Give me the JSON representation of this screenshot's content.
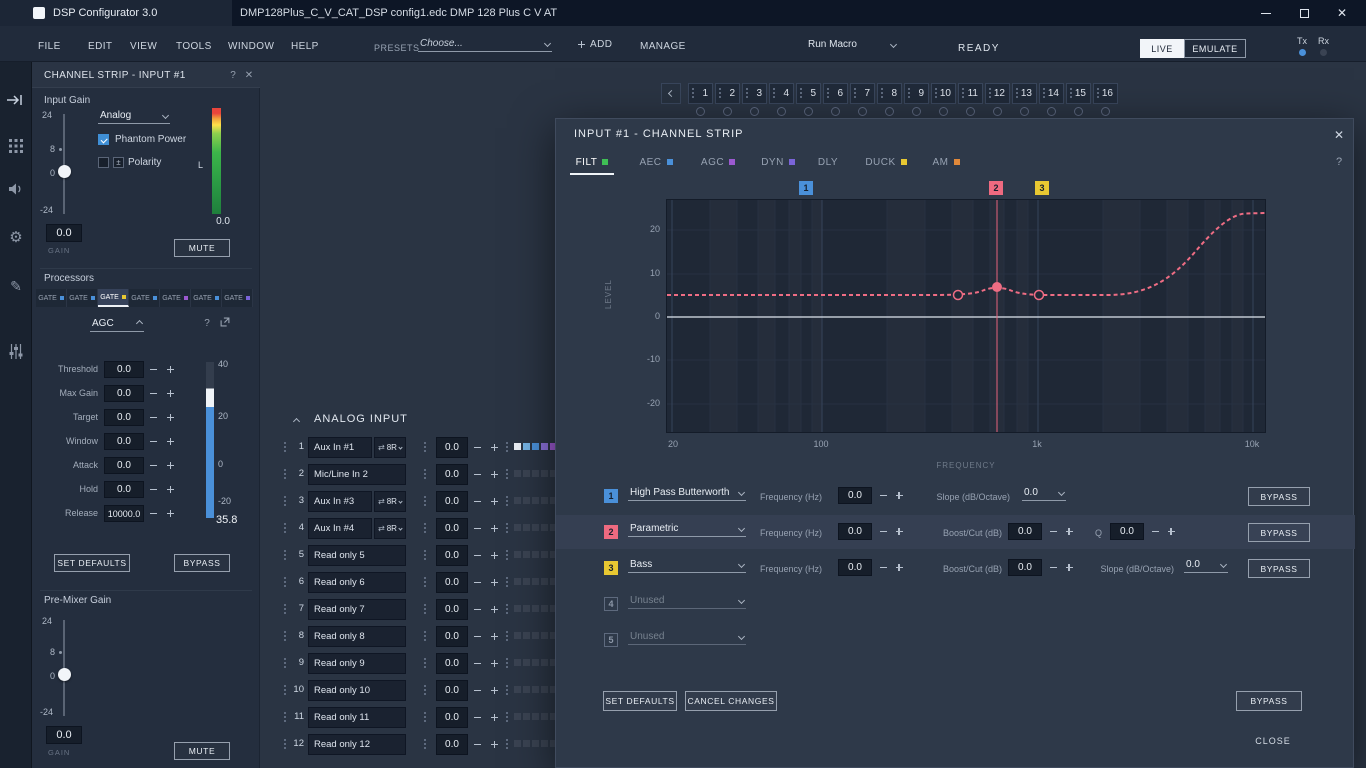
{
  "glyphs": {
    "close": "✕",
    "help": "?",
    "gear": "⚙",
    "pencil": "✎",
    "swap": "⇄",
    "polarity": "±"
  },
  "titlebar": {
    "app_title": "DSP Configurator 3.0",
    "document_title": "DMP128Plus_C_V_CAT_DSP config1.edc DMP 128 Plus C V AT"
  },
  "menubar": {
    "items": [
      "FILE",
      "EDIT",
      "VIEW",
      "TOOLS",
      "WINDOW",
      "HELP"
    ],
    "presets_label": "PRESETS",
    "presets_value": "Choose...",
    "add_label": "ADD",
    "manage_label": "MANAGE",
    "macro_value": "Run Macro",
    "status": "READY",
    "live_label": "LIVE",
    "emulate_label": "EMULATE",
    "tx_label": "Tx",
    "rx_label": "Rx"
  },
  "channel_strip": {
    "title": "CHANNEL STRIP - INPUT #1",
    "input_gain": {
      "section_label": "Input Gain",
      "source_value": "Analog",
      "phantom_label": "Phantom Power",
      "polarity_label": "Polarity",
      "ticks": [
        "24",
        "8",
        "0",
        "-24"
      ],
      "gain_value": "0.0",
      "gain_caption": "GAIN",
      "meter_channel": "L",
      "meter_value": "0.0",
      "mute_label": "MUTE"
    },
    "processors": {
      "section_label": "Processors",
      "slot_tabs": [
        {
          "label": "GATE",
          "color": "#4a90d9"
        },
        {
          "label": "GATE",
          "color": "#4a90d9"
        },
        {
          "label": "GATE",
          "color": "#e8c832"
        },
        {
          "label": "GATE",
          "color": "#4a90d9"
        },
        {
          "label": "GATE",
          "color": "#9b59d0"
        },
        {
          "label": "GATE",
          "color": "#4a90d9"
        },
        {
          "label": "GATE",
          "color": "#7a64d8"
        }
      ],
      "selected_type": "AGC",
      "params": [
        {
          "label": "Threshold",
          "value": "0.0"
        },
        {
          "label": "Max Gain",
          "value": "0.0"
        },
        {
          "label": "Target",
          "value": "0.0"
        },
        {
          "label": "Window",
          "value": "0.0"
        },
        {
          "label": "Attack",
          "value": "0.0"
        },
        {
          "label": "Hold",
          "value": "0.0"
        },
        {
          "label": "Release",
          "value": "10000.0"
        }
      ],
      "meter_ticks": [
        "40",
        "20",
        "0",
        "-20"
      ],
      "meter_value": "35.8",
      "set_defaults_label": "SET DEFAULTS",
      "bypass_label": "BYPASS"
    },
    "pre_mixer": {
      "section_label": "Pre-Mixer Gain",
      "ticks": [
        "24",
        "8",
        "0",
        "-24"
      ],
      "gain_value": "0.0",
      "gain_caption": "GAIN",
      "mute_label": "MUTE"
    }
  },
  "workspace": {
    "channel_tabs": [
      "1",
      "2",
      "3",
      "4",
      "5",
      "6",
      "7",
      "8",
      "9",
      "10",
      "11",
      "12",
      "13",
      "14",
      "15",
      "16"
    ],
    "analog_input": {
      "title": "ANALOG INPUT",
      "rows": [
        {
          "num": "1",
          "name": "Aux In #1",
          "route": "8R",
          "gain": "0.0"
        },
        {
          "num": "2",
          "name": "Mic/Line In 2",
          "gain": "0.0"
        },
        {
          "num": "3",
          "name": "Aux In #3",
          "route": "8R",
          "gain": "0.0"
        },
        {
          "num": "4",
          "name": "Aux In #4",
          "route": "8R",
          "gain": "0.0"
        },
        {
          "num": "5",
          "name": "Read only 5",
          "gain": "0.0"
        },
        {
          "num": "6",
          "name": "Read only 6",
          "gain": "0.0"
        },
        {
          "num": "7",
          "name": "Read only 7",
          "gain": "0.0"
        },
        {
          "num": "8",
          "name": "Read only 8",
          "gain": "0.0"
        },
        {
          "num": "9",
          "name": "Read only 9",
          "gain": "0.0"
        },
        {
          "num": "10",
          "name": "Read only 10",
          "gain": "0.0"
        },
        {
          "num": "11",
          "name": "Read only 11",
          "gain": "0.0"
        },
        {
          "num": "12",
          "name": "Read only 12",
          "gain": "0.0"
        }
      ]
    }
  },
  "modal": {
    "title": "INPUT #1 - CHANNEL STRIP",
    "tabs": [
      {
        "label": "FILT",
        "color": "#3fbf55",
        "active": true
      },
      {
        "label": "AEC",
        "color": "#4a90d9",
        "active": false
      },
      {
        "label": "AGC",
        "color": "#9b59d0",
        "active": false
      },
      {
        "label": "DYN",
        "color": "#7a64d8",
        "active": false
      },
      {
        "label": "DLY",
        "color": "",
        "active": false
      },
      {
        "label": "DUCK",
        "color": "#e8c832",
        "active": false
      },
      {
        "label": "AM",
        "color": "#e0883a",
        "active": false
      }
    ],
    "graph": {
      "ylabel": "LEVEL",
      "xlabel": "FREQUENCY",
      "y_ticks": [
        "20",
        "10",
        "0",
        "-10",
        "-20"
      ],
      "x_ticks": [
        "20",
        "100",
        "1k",
        "10k"
      ],
      "curve_color": "#ef6d84",
      "markers": [
        {
          "num": "1",
          "color": "#4a90d9"
        },
        {
          "num": "2",
          "color": "#ee6a80"
        },
        {
          "num": "3",
          "color": "#e8c832"
        }
      ]
    },
    "filters": [
      {
        "num": "1",
        "type": "High Pass Butterworth",
        "freq_label": "Frequency (Hz)",
        "freq_value": "0.0",
        "slope_label": "Slope (dB/Octave)",
        "slope_value": "0.0",
        "bypass_label": "BYPASS",
        "badge_color": "#4a90d9"
      },
      {
        "num": "2",
        "type": "Parametric",
        "freq_label": "Frequency (Hz)",
        "freq_value": "0.0",
        "boost_label": "Boost/Cut (dB)",
        "boost_value": "0.0",
        "q_label": "Q",
        "q_value": "0.0",
        "bypass_label": "BYPASS",
        "badge_color": "#ee6a80",
        "highlighted": true
      },
      {
        "num": "3",
        "type": "Bass",
        "freq_label": "Frequency (Hz)",
        "freq_value": "0.0",
        "boost_label": "Boost/Cut (dB)",
        "boost_value": "0.0",
        "slope_label": "Slope (dB/Octave)",
        "slope_value": "0.0",
        "bypass_label": "BYPASS",
        "badge_color": "#e8c832"
      },
      {
        "num": "4",
        "type": "Unused"
      },
      {
        "num": "5",
        "type": "Unused"
      }
    ],
    "footer": {
      "set_defaults": "SET DEFAULTS",
      "cancel_changes": "CANCEL CHANGES",
      "bypass": "BYPASS",
      "close": "CLOSE"
    }
  }
}
